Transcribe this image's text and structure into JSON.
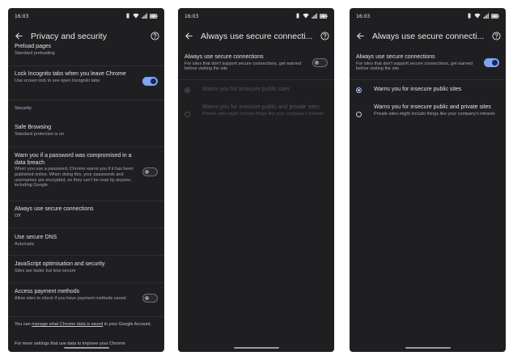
{
  "status_bar": {
    "time": "16:03"
  },
  "screen1": {
    "title": "Privacy and security",
    "items": [
      {
        "title": "Preload pages",
        "subtitle": "Standard preloading"
      },
      {
        "title": "Lock Incognito tabs when you leave Chrome",
        "subtitle": "Use screen lock to see open Incognito tabs",
        "toggle": "on"
      },
      {
        "section": "Security"
      },
      {
        "title": "Safe Browsing",
        "subtitle": "Standard protection is on"
      },
      {
        "title": "Warn you if a password was compromised in a data breach",
        "subtitle": "When you use a password, Chrome warns you if it has been published online. When doing this, your passwords and usernames are encrypted, so they can't be read by anyone, including Google.",
        "toggle": "off"
      },
      {
        "title": "Always use secure connections",
        "subtitle": "Off"
      },
      {
        "title": "Use secure DNS",
        "subtitle": "Automatic"
      },
      {
        "title": "JavaScript optimisation and security",
        "subtitle": "Sites are faster but less secure"
      },
      {
        "title": "Access payment methods",
        "subtitle": "Allow sites to check if you have payment methods saved",
        "toggle": "off"
      }
    ],
    "footer_pre": "You can ",
    "footer_link": "manage what Chrome data is saved",
    "footer_post": " in your Google Account.",
    "footer2": "For more settings that use data to improve your Chrome"
  },
  "screen2": {
    "title": "Always use secure connecti...",
    "main_title": "Always use secure connections",
    "main_subtitle": "For sites that don't support secure connections, get warned before visiting the site",
    "toggle": "off",
    "options": [
      {
        "title": "Warns you for insecure public sites",
        "selected": true
      },
      {
        "title": "Warns you for insecure public and private sites",
        "subtitle": "Private sites might include things like your company's intranet",
        "selected": false
      }
    ]
  },
  "screen3": {
    "title": "Always use secure connecti...",
    "main_title": "Always use secure connections",
    "main_subtitle": "For sites that don't support secure connections, get warned before visiting the site",
    "toggle": "on",
    "options": [
      {
        "title": "Warns you for insecure public sites",
        "selected": true
      },
      {
        "title": "Warns you for insecure public and private sites",
        "subtitle": "Private sites might include things like your company's intranet",
        "selected": false
      }
    ]
  },
  "icons": [
    "back-arrow-icon",
    "help-circle-icon",
    "vibrate-icon",
    "wifi-icon",
    "signal-icon",
    "battery-icon"
  ]
}
